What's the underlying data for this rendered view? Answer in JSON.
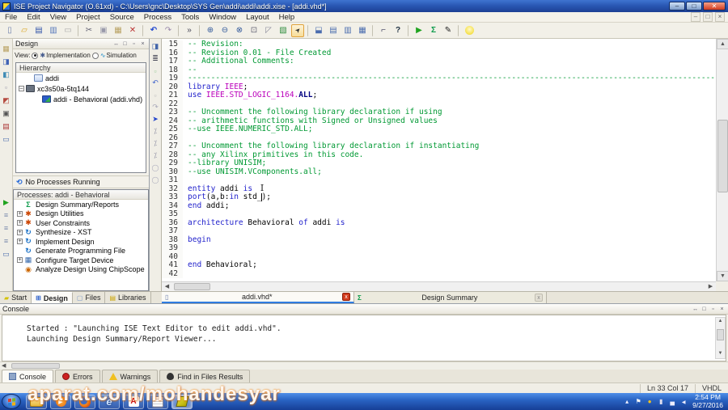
{
  "titlebar": {
    "title": "ISE Project Navigator (O.61xd) - C:\\Users\\gnc\\Desktop\\SYS Gen\\addi\\addi\\addi.xise - [addi.vhd*]"
  },
  "menus": [
    "File",
    "Edit",
    "View",
    "Project",
    "Source",
    "Process",
    "Tools",
    "Window",
    "Layout",
    "Help"
  ],
  "toolbar_icons": [
    "new-file",
    "open-project",
    "save",
    "save-all",
    "print",
    "sep",
    "cut",
    "copy",
    "paste",
    "delete",
    "sep",
    "undo",
    "redo",
    "sep",
    "more",
    "sep",
    "zoom-in",
    "zoom-out",
    "zoom-full",
    "zoom-region",
    "zoom-prev",
    "view-report",
    "pointer",
    "sep",
    "new-window",
    "cascade",
    "tile-h",
    "tile-v",
    "sep",
    "wrench",
    "help",
    "sep",
    "run",
    "design-summary",
    "text-editor",
    "sep",
    "lightbulb"
  ],
  "left_strip_icons": [
    "paste2",
    "lib-add",
    "lib-upd",
    "snap",
    "lib-del",
    "archive",
    "report2",
    "win"
  ],
  "left_strip_icons2": [
    "run",
    "proc1",
    "proc2",
    "proc3",
    "win2"
  ],
  "editor_strip_icons": [
    "goto",
    "runlines",
    "sq1",
    "undo",
    "sq2",
    "redo",
    "nav",
    "pct1",
    "pct2",
    "pct3",
    "c1",
    "c2"
  ],
  "design_panel": {
    "title": "Design",
    "view_label": "View:",
    "view_impl": "Implementation",
    "view_sim": "Simulation",
    "hierarchy_title": "Hierarchy",
    "tree": [
      {
        "label": "addi",
        "icon": "proj",
        "exp": "none",
        "indent": 1
      },
      {
        "label": "xc3s50a-5tq144",
        "icon": "chip",
        "exp": "minus",
        "indent": 0
      },
      {
        "label": "addi - Behavioral (addi.vhd)",
        "icon": "vhdl",
        "exp": "none",
        "indent": 2
      }
    ],
    "status": "No Processes Running",
    "processes_title": "Processes: addi - Behavioral",
    "processes": [
      {
        "label": "Design Summary/Reports",
        "icon": "sigma",
        "exp": "none"
      },
      {
        "label": "Design Utilities",
        "icon": "util",
        "exp": "plus"
      },
      {
        "label": "User Constraints",
        "icon": "util",
        "exp": "plus"
      },
      {
        "label": "Synthesize - XST",
        "icon": "syn",
        "exp": "plus"
      },
      {
        "label": "Implement Design",
        "icon": "syn",
        "exp": "plus"
      },
      {
        "label": "Generate Programming File",
        "icon": "syn",
        "exp": "none"
      },
      {
        "label": "Configure Target Device",
        "icon": "dev",
        "exp": "plus"
      },
      {
        "label": "Analyze Design Using ChipScope",
        "icon": "scope",
        "exp": "none"
      }
    ]
  },
  "left_tabs": [
    {
      "label": "Start",
      "icon": "start",
      "active": false
    },
    {
      "label": "Design",
      "icon": "design",
      "active": true
    },
    {
      "label": "Files",
      "icon": "files",
      "active": false
    },
    {
      "label": "Libraries",
      "icon": "libs",
      "active": false
    }
  ],
  "editor": {
    "tabs": [
      {
        "label": "addi.vhd*",
        "icon": "doc",
        "close": "red",
        "active": true
      },
      {
        "label": "Design Summary",
        "icon": "sigma",
        "close": "gray",
        "active": false
      }
    ],
    "lines": [
      {
        "n": 15,
        "segs": [
          {
            "t": "-- Revision:",
            "c": "com"
          }
        ]
      },
      {
        "n": 16,
        "segs": [
          {
            "t": "-- Revision 0.01 - File Created",
            "c": "com"
          }
        ]
      },
      {
        "n": 17,
        "segs": [
          {
            "t": "-- Additional Comments:",
            "c": "com"
          }
        ]
      },
      {
        "n": 18,
        "segs": [
          {
            "t": "--",
            "c": "com"
          }
        ]
      },
      {
        "n": 19,
        "segs": [
          {
            "t": "----------------------------------------------------------------------------------------------------------------------------------",
            "c": "com"
          }
        ]
      },
      {
        "n": 20,
        "segs": [
          {
            "t": "library ",
            "c": "kw"
          },
          {
            "t": "IEEE",
            "c": "lib"
          },
          {
            "t": ";",
            "c": "pl"
          }
        ]
      },
      {
        "n": 21,
        "segs": [
          {
            "t": "use ",
            "c": "kw"
          },
          {
            "t": "IEEE.STD_LOGIC_1164.",
            "c": "lib"
          },
          {
            "t": "ALL",
            "c": "typ"
          },
          {
            "t": ";",
            "c": "pl"
          }
        ]
      },
      {
        "n": 22,
        "segs": []
      },
      {
        "n": 23,
        "segs": [
          {
            "t": "-- Uncomment the following library declaration if using",
            "c": "com"
          }
        ]
      },
      {
        "n": 24,
        "segs": [
          {
            "t": "-- arithmetic functions with Signed or Unsigned values",
            "c": "com"
          }
        ]
      },
      {
        "n": 25,
        "segs": [
          {
            "t": "--use IEEE.NUMERIC_STD.ALL;",
            "c": "com"
          }
        ]
      },
      {
        "n": 26,
        "segs": []
      },
      {
        "n": 27,
        "segs": [
          {
            "t": "-- Uncomment the following library declaration if instantiating",
            "c": "com"
          }
        ]
      },
      {
        "n": 28,
        "segs": [
          {
            "t": "-- any Xilinx primitives in this code.",
            "c": "com"
          }
        ]
      },
      {
        "n": 29,
        "segs": [
          {
            "t": "--library UNISIM;",
            "c": "com"
          }
        ]
      },
      {
        "n": 30,
        "segs": [
          {
            "t": "--use UNISIM.VComponents.all;",
            "c": "com"
          }
        ]
      },
      {
        "n": 31,
        "segs": []
      },
      {
        "n": 32,
        "segs": [
          {
            "t": "entity",
            "c": "kw"
          },
          {
            "t": " addi ",
            "c": "pl"
          },
          {
            "t": "is",
            "c": "kw"
          }
        ]
      },
      {
        "n": 33,
        "segs": [
          {
            "t": "port",
            "c": "kw"
          },
          {
            "t": "(a,b:",
            "c": "pl"
          },
          {
            "t": "in",
            "c": "kw"
          },
          {
            "t": " std_",
            "c": "pl"
          },
          {
            "t": ");",
            "c": "pl"
          }
        ]
      },
      {
        "n": 34,
        "segs": [
          {
            "t": "end",
            "c": "kw"
          },
          {
            "t": " addi;",
            "c": "pl"
          }
        ]
      },
      {
        "n": 35,
        "segs": []
      },
      {
        "n": 36,
        "segs": [
          {
            "t": "architecture",
            "c": "kw"
          },
          {
            "t": " Behavioral ",
            "c": "pl"
          },
          {
            "t": "of",
            "c": "kw"
          },
          {
            "t": " addi ",
            "c": "pl"
          },
          {
            "t": "is",
            "c": "kw"
          }
        ]
      },
      {
        "n": 37,
        "segs": []
      },
      {
        "n": 38,
        "segs": [
          {
            "t": "begin",
            "c": "kw"
          }
        ]
      },
      {
        "n": 39,
        "segs": []
      },
      {
        "n": 40,
        "segs": []
      },
      {
        "n": 41,
        "segs": [
          {
            "t": "end",
            "c": "kw"
          },
          {
            "t": " Behavioral;",
            "c": "pl"
          }
        ]
      },
      {
        "n": 42,
        "segs": []
      }
    ]
  },
  "console": {
    "title": "Console",
    "lines": [
      "Started : \"Launching ISE Text Editor to edit addi.vhd\".",
      "Launching Design Summary/Report Viewer..."
    ],
    "tabs": [
      {
        "label": "Console",
        "icon": "console",
        "active": true
      },
      {
        "label": "Errors",
        "icon": "error",
        "active": false
      },
      {
        "label": "Warnings",
        "icon": "warn",
        "active": false
      },
      {
        "label": "Find in Files Results",
        "icon": "find",
        "active": false
      }
    ]
  },
  "statusbar": {
    "position": "Ln 33 Col 17",
    "mode": "VHDL"
  },
  "taskbar": {
    "apps": [
      {
        "name": "explorer",
        "active": false
      },
      {
        "name": "media",
        "active": false
      },
      {
        "name": "firefox",
        "active": false
      },
      {
        "name": "ie",
        "active": false
      },
      {
        "name": "pdf",
        "active": false
      },
      {
        "name": "notes",
        "active": false
      },
      {
        "name": "ise",
        "active": true
      }
    ],
    "tray_icons": [
      "expand",
      "flag",
      "app",
      "usb",
      "net",
      "vol"
    ],
    "clock_time": "2:54 PM",
    "clock_date": "9/27/2016"
  },
  "watermark": "aparat.com/mohandesyar",
  "colors": {
    "accent_blue": "#2f7ce0",
    "keyword": "#2222cc",
    "comment": "#009933",
    "library": "#bb00bb",
    "taskbar_blue": "#2a64c4"
  }
}
